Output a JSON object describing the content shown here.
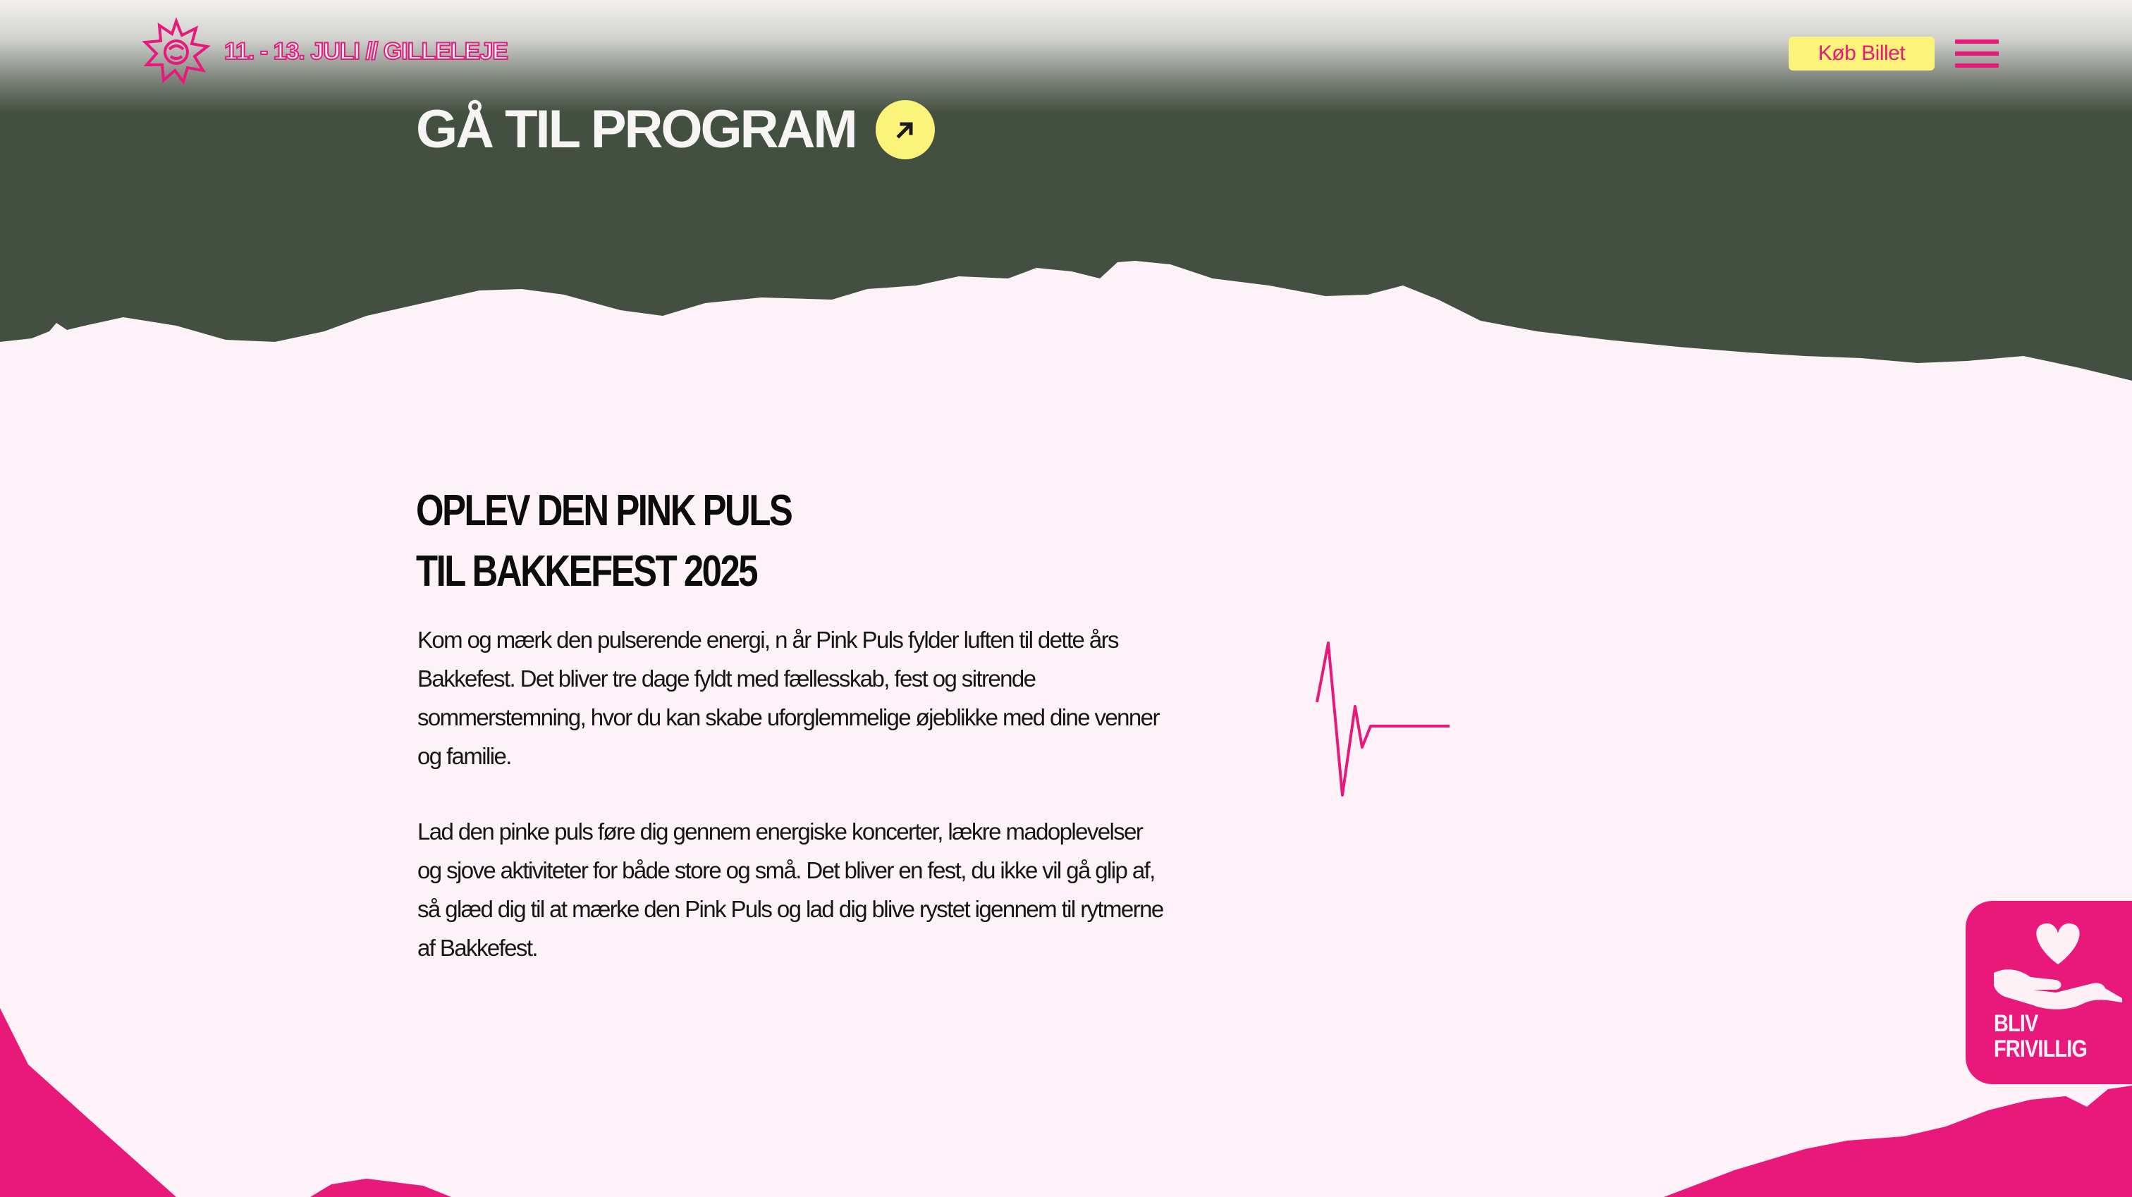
{
  "header": {
    "dates": "11. - 13. JULI // GILLELEJE",
    "buy_ticket_label": "Køb Billet"
  },
  "hero": {
    "program_link_label": "GÅ TIL PROGRAM"
  },
  "main": {
    "heading_line1": "OPLEV DEN PINK PULS",
    "heading_line2": "TIL BAKKEFEST 2025",
    "paragraph1": "Kom og mærk den pulserende energi, n år Pink Puls fylder luften til dette års Bakkefest. Det bliver tre dage fyldt med fællesskab, fest og sitrende sommerstemning, hvor du kan skabe uforglemmelige øjeblikke med dine venner og familie.",
    "paragraph2": "Lad den pinke puls føre dig gennem energiske koncerter, lækre madoplevelser og sjove aktiviteter for både store og små. Det bliver en fest, du ikke vil gå glip af, så glæd dig til at mærke den Pink Puls og lad dig blive rystet igennem til rytmerne af Bakkefest."
  },
  "volunteer": {
    "line1": "BLIV",
    "line2": "FRIVILLIG"
  },
  "colors": {
    "pink": "#e8197b",
    "yellow": "#fbf37a",
    "dark_green": "#434f40",
    "background": "#fcf2f7"
  },
  "icons": {
    "logo": "flower-sun-logo-icon",
    "arrow": "arrow-up-right-icon",
    "menu": "hamburger-menu-icon",
    "pulse": "heartbeat-pulse-icon",
    "volunteer": "heart-in-hand-icon"
  }
}
